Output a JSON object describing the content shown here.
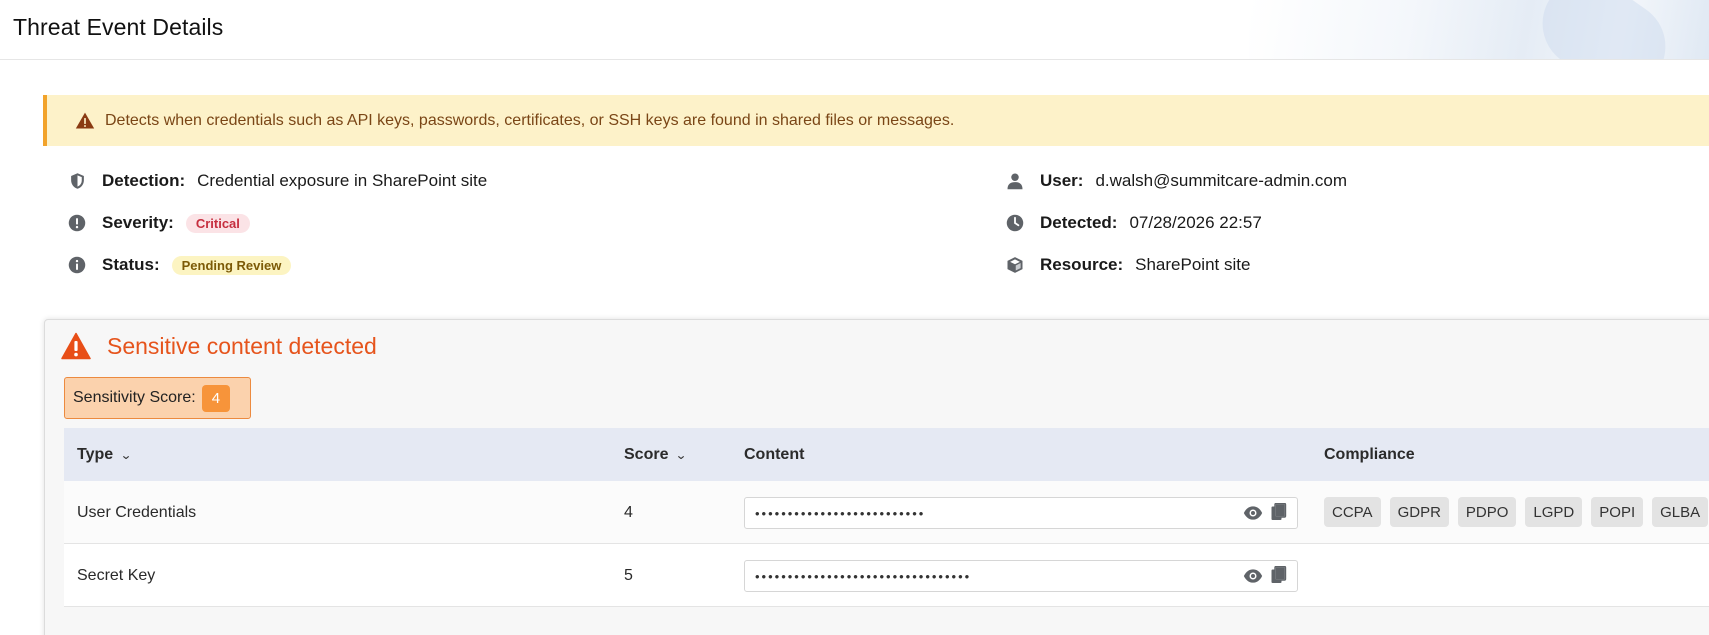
{
  "header": {
    "title": "Threat Event Details"
  },
  "alert": {
    "text": "Detects when credentials such as API keys, passwords, certificates, or SSH keys are found in shared files or messages."
  },
  "details": {
    "detection": {
      "label": "Detection:",
      "value": "Credential exposure in SharePoint site",
      "icon": "shield-icon"
    },
    "severity": {
      "label": "Severity:",
      "value": "Critical",
      "icon": "exclamation-circle-icon"
    },
    "status": {
      "label": "Status:",
      "value": "Pending Review",
      "icon": "info-circle-icon"
    },
    "user": {
      "label": "User:",
      "value": "d.walsh@summitcare-admin.com",
      "icon": "user-icon"
    },
    "detected": {
      "label": "Detected:",
      "value": "07/28/2026 22:57",
      "icon": "clock-icon"
    },
    "resource": {
      "label": "Resource:",
      "value": "SharePoint site",
      "icon": "cube-icon"
    }
  },
  "sensitive": {
    "title": "Sensitive content detected",
    "score_label": "Sensitivity Score:",
    "score_value": "4"
  },
  "table": {
    "columns": {
      "type": "Type",
      "score": "Score",
      "content": "Content",
      "compliance": "Compliance"
    },
    "rows": [
      {
        "type": "User Credentials",
        "score": "4",
        "content": "••••••••••••••••••••••••••",
        "compliance": [
          "CCPA",
          "GDPR",
          "PDPO",
          "LGPD",
          "POPI",
          "GLBA"
        ]
      },
      {
        "type": "Secret Key",
        "score": "5",
        "content": "•••••••••••••••••••••••••••••••••",
        "compliance": []
      }
    ]
  },
  "colors": {
    "alert_bg": "#fdf2c9",
    "alert_border": "#f2a32b",
    "critical": "#c62f3f",
    "sensitive_title": "#e6541c",
    "score_badge": "#f7943a",
    "table_header": "#e5e9f3"
  }
}
